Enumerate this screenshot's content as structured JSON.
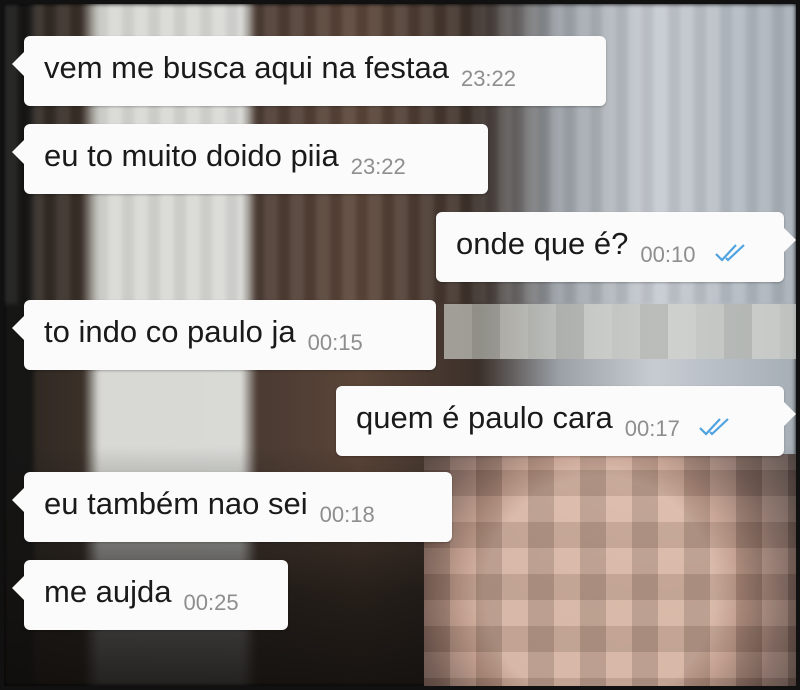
{
  "messages": [
    {
      "direction": "in",
      "text": "vem me busca aqui na festaa",
      "time": "23:22"
    },
    {
      "direction": "in",
      "text": "eu to muito doido piia",
      "time": "23:22"
    },
    {
      "direction": "out",
      "text": "onde que é?",
      "time": "00:10",
      "status": "read-double-check"
    },
    {
      "direction": "in",
      "text": "to indo co paulo ja",
      "time": "00:15"
    },
    {
      "direction": "out",
      "text": "quem é paulo cara",
      "time": "00:17",
      "status": "read-double-check"
    },
    {
      "direction": "in",
      "text": "eu também  nao sei",
      "time": "00:18"
    },
    {
      "direction": "in",
      "text": "me aujda",
      "time": "00:25"
    }
  ],
  "colors": {
    "bubble": "#fbfbfb",
    "text": "#1a1a1a",
    "time": "#8e8e8e",
    "read_ticks": "#4fa3e0"
  }
}
